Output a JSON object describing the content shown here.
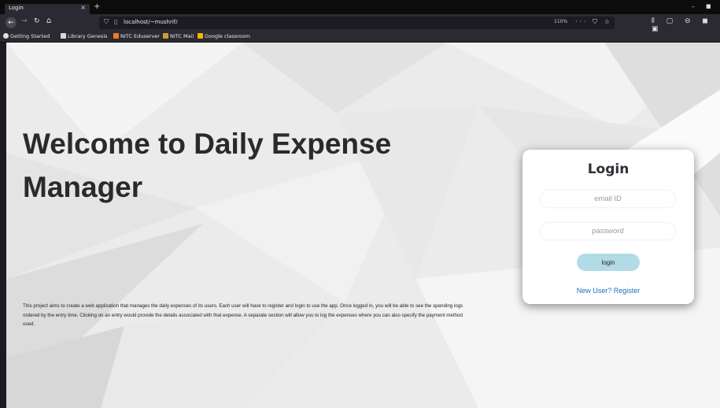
{
  "browser": {
    "tab_title": "Login",
    "tab_close": "×",
    "new_tab": "+",
    "url": "localhost/~mushrif/",
    "zoom": "110%",
    "url_icons": "··· ⛉ ☆",
    "right_icons": "⫴ ▢ ⊖ ◼ ▣"
  },
  "bookmarks": [
    {
      "label": "Getting Started",
      "icon_color": "#e0e0e0"
    },
    {
      "label": "Library Genesis",
      "icon_color": "#d8d8d8"
    },
    {
      "label": "NITC Eduserver",
      "icon_color": "#f07c1e"
    },
    {
      "label": "NITC Mail",
      "icon_color": "#c9a227"
    },
    {
      "label": "Google classroom",
      "icon_color": "#f4b400"
    }
  ],
  "page": {
    "headline": "Welcome to Daily Expense Manager",
    "description": "This project aims to create a web application that manages the daily expenses of its users. Each user will have to register and login to use the app. Once logged in, you will be able to see the spending logs ordered by the entry time. Clicking on an entry would provide the details associated with that expense. A separate section will allow you to log the expenses where you can also specify the payment method used."
  },
  "login": {
    "title": "Login",
    "email_placeholder": "email ID",
    "password_placeholder": "password",
    "button_label": "login",
    "register_link": "New User? Register"
  },
  "colors": {
    "accent_button": "#b3dbe6",
    "link": "#1f6fc1"
  }
}
